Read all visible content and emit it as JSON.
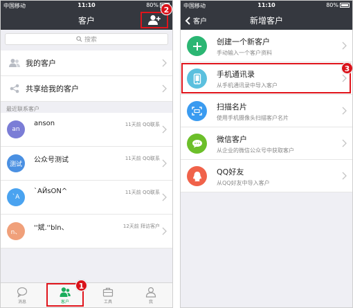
{
  "status_bar": {
    "carrier": "中国移动",
    "time": "11:10",
    "battery": "80%"
  },
  "left_screen": {
    "title": "客户",
    "search_placeholder": "搜索",
    "menu": [
      {
        "label": "我的客户",
        "icon": "people-icon"
      },
      {
        "label": "共享给我的客户",
        "icon": "share-icon"
      }
    ],
    "section_label": "最近联系客户",
    "contacts": [
      {
        "avatar_text": "an",
        "avatar_color": "#7b7dd6",
        "name": "anson",
        "meta": "11天前 QQ联系"
      },
      {
        "avatar_text": "测试",
        "avatar_color": "#4a90e2",
        "name": "公众号测试",
        "meta": "11天前 QQ联系"
      },
      {
        "avatar_text": "`A",
        "avatar_color": "#4aa3f0",
        "name": "`AЙsON^",
        "meta": "11天前 QQ联系"
      },
      {
        "avatar_text": "n、",
        "avatar_color": "#f0a07a",
        "name": "''斌.''bln、",
        "meta": "12天前 拜访客户"
      }
    ],
    "tabs": [
      {
        "label": "消息",
        "icon": "chat-bubble-icon"
      },
      {
        "label": "客户",
        "icon": "customers-icon",
        "active": true
      },
      {
        "label": "工具",
        "icon": "briefcase-icon"
      },
      {
        "label": "我",
        "icon": "profile-icon"
      }
    ]
  },
  "right_screen": {
    "back_label": "客户",
    "title": "新增客户",
    "options": [
      {
        "title": "创建一个新客户",
        "subtitle": "手动输入一个客户资料",
        "icon": "plus-icon",
        "color": "#2bb673"
      },
      {
        "title": "手机通讯录",
        "subtitle": "从手机通讯录中导入客户",
        "icon": "phone-icon",
        "color": "#5bc0de"
      },
      {
        "title": "扫描名片",
        "subtitle": "使用手机摄像头扫描客户名片",
        "icon": "scan-icon",
        "color": "#3a9bf0"
      },
      {
        "title": "微信客户",
        "subtitle": "从企业的微信公众号中获取客户",
        "icon": "wechat-icon",
        "color": "#6cbf2a"
      },
      {
        "title": "QQ好友",
        "subtitle": "从QQ好友中导入客户",
        "icon": "qq-icon",
        "color": "#f0624a"
      }
    ]
  },
  "annotations": {
    "step1": "1",
    "step2": "2",
    "step3": "3"
  },
  "colors": {
    "nav_bg": "#35383f",
    "accent_green": "#1aad5c",
    "highlight_red": "#e0141b"
  }
}
